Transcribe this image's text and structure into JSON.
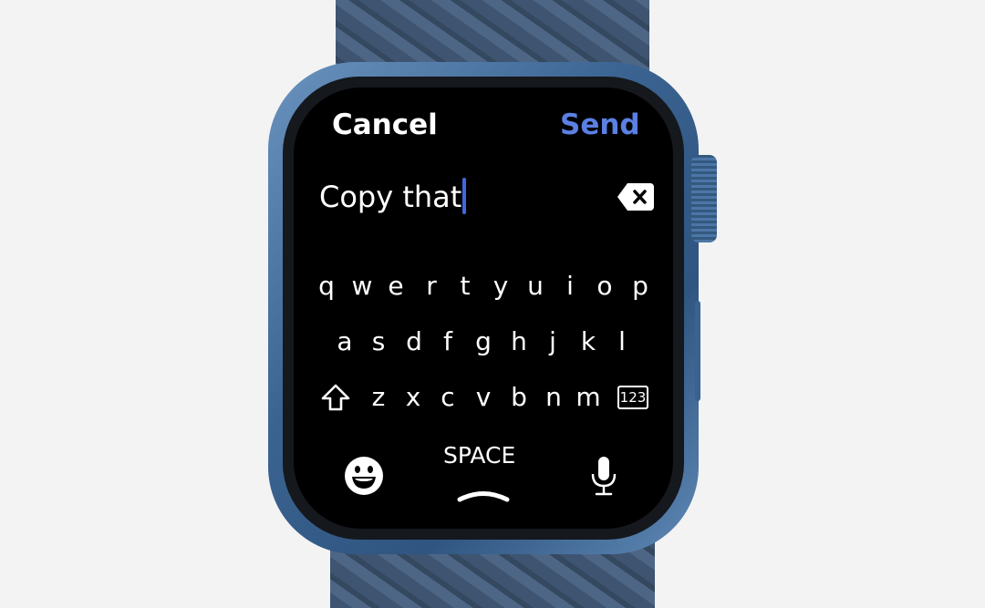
{
  "header": {
    "cancel_label": "Cancel",
    "send_label": "Send"
  },
  "input": {
    "value": "Copy that"
  },
  "keyboard": {
    "rows": [
      [
        "q",
        "w",
        "e",
        "r",
        "t",
        "y",
        "u",
        "i",
        "o",
        "p"
      ],
      [
        "a",
        "s",
        "d",
        "f",
        "g",
        "h",
        "j",
        "k",
        "l"
      ],
      [
        "z",
        "x",
        "c",
        "v",
        "b",
        "n",
        "m"
      ]
    ],
    "numbers_label": "123",
    "space_label": "SPACE"
  },
  "icons": {
    "delete": "delete-backspace-icon",
    "shift": "shift-arrow-icon",
    "emoji": "emoji-smiley-icon",
    "mic": "microphone-icon",
    "chevron": "chevron-up-icon"
  },
  "colors": {
    "accent": "#5b7fe3",
    "cursor": "#3f67e0",
    "case": "#3b6391",
    "screen": "#000000"
  }
}
